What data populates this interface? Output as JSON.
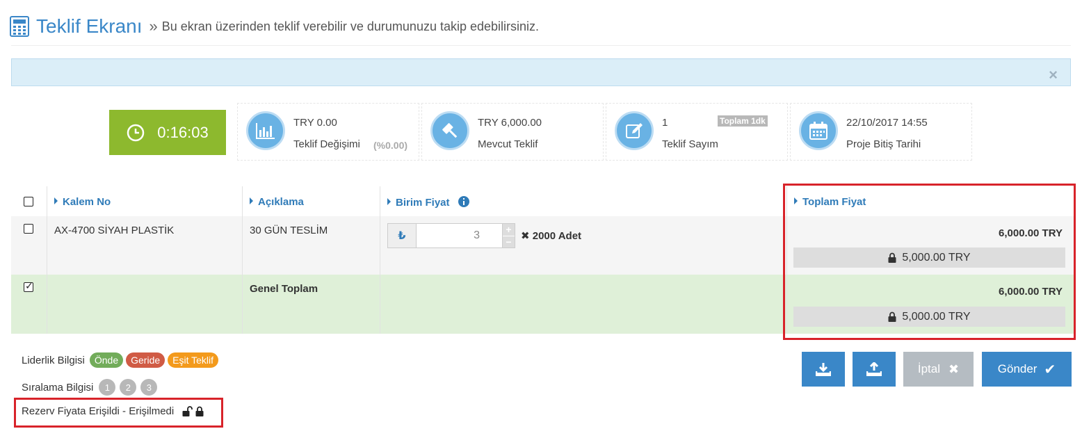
{
  "header": {
    "title": "Teklif Ekranı",
    "separator": "»",
    "subtitle": "Bu ekran üzerinden teklif verebilir ve durumunuzu takip edebilirsiniz.",
    "icon": "calculator-icon"
  },
  "alert": {
    "close_label": "×"
  },
  "timer": {
    "value": "0:16:03",
    "icon": "clock-icon",
    "color": "#8db92e"
  },
  "stats": [
    {
      "value": "TRY 0.00",
      "label": "Teklif Değişimi",
      "extra": "(%0.00)",
      "icon": "bar-chart-icon"
    },
    {
      "value": "TRY 6,000.00",
      "label": "Mevcut Teklif",
      "icon": "gavel-icon"
    },
    {
      "value": "1",
      "label": "Teklif Sayım",
      "tag": "Toplam 1dk",
      "icon": "edit-icon"
    },
    {
      "value": "22/10/2017 14:55",
      "label": "Proje Bitiş Tarihi",
      "icon": "calendar-icon"
    }
  ],
  "table": {
    "columns": [
      "Kalem No",
      "Açıklama",
      "Birim Fiyat",
      "Toplam Fiyat"
    ],
    "rows": [
      {
        "item_no": "AX-4700 SİYAH PLASTİK",
        "description": "30 GÜN TESLİM",
        "unit_price": "3",
        "currency_symbol": "₺",
        "quantity": "✖ 2000 Adet",
        "total": "6,000.00 TRY",
        "reserve": "5,000.00 TRY"
      }
    ],
    "summary": {
      "label": "Genel Toplam",
      "total": "6,000.00 TRY",
      "reserve": "5,000.00 TRY"
    }
  },
  "legend": {
    "leadership_label": "Liderlik Bilgisi",
    "leadership_badges": [
      "Önde",
      "Geride",
      "Eşit Teklif"
    ],
    "ranking_label": "Sıralama Bilgisi",
    "ranking_badges": [
      "1",
      "2",
      "3"
    ],
    "reserve_label": "Rezerv Fiyata Erişildi - Erişilmedi"
  },
  "buttons": {
    "cancel": "İptal",
    "submit": "Gönder"
  },
  "colors": {
    "accent": "#3a87c8",
    "success_bg": "#dff0d8",
    "highlight": "#d8232a"
  }
}
